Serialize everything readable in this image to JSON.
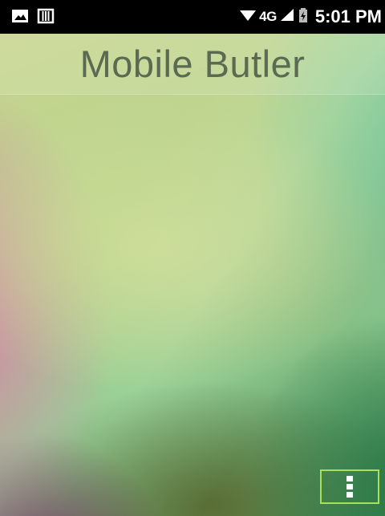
{
  "status_bar": {
    "left_icons": [
      "gallery-icon",
      "sim-card-icon"
    ],
    "network_type": "4G",
    "time": "5:01 PM",
    "right_icons": [
      "wifi-icon",
      "signal-icon",
      "battery-charging-icon"
    ]
  },
  "app": {
    "title": "Mobile Butler"
  },
  "menu_button": {
    "icon": "overflow-menu-icon",
    "accent_color": "#a9e05a"
  }
}
